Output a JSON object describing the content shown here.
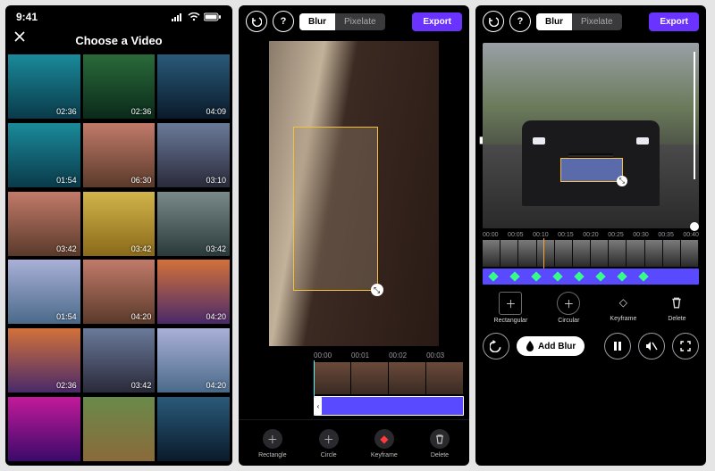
{
  "status": {
    "time": "9:41"
  },
  "gallery": {
    "title": "Choose a Video",
    "thumbs": [
      {
        "dur": "02:36",
        "cls": "ocean"
      },
      {
        "dur": "02:36",
        "cls": "forest"
      },
      {
        "dur": "04:09",
        "cls": "water"
      },
      {
        "dur": "01:54",
        "cls": "ocean"
      },
      {
        "dur": "06:30",
        "cls": "people"
      },
      {
        "dur": "03:10",
        "cls": "city"
      },
      {
        "dur": "03:42",
        "cls": "people"
      },
      {
        "dur": "03:42",
        "cls": "food"
      },
      {
        "dur": "03:42",
        "cls": "bridge"
      },
      {
        "dur": "01:54",
        "cls": "beach"
      },
      {
        "dur": "04:20",
        "cls": "people"
      },
      {
        "dur": "04:20",
        "cls": "sunset"
      },
      {
        "dur": "02:36",
        "cls": "sunset"
      },
      {
        "dur": "03:42",
        "cls": "city"
      },
      {
        "dur": "04:20",
        "cls": "beach"
      },
      {
        "dur": "",
        "cls": "abstract"
      },
      {
        "dur": "",
        "cls": "hill"
      },
      {
        "dur": "",
        "cls": "water"
      }
    ]
  },
  "editor": {
    "tabs": {
      "blur": "Blur",
      "pixelate": "Pixelate"
    },
    "export": "Export",
    "ticks2": [
      "00:00",
      "00:01",
      "00:02",
      "00:03"
    ],
    "tools": {
      "rectangle": "Rectangle",
      "circle": "Circle",
      "keyframe": "Keyframe",
      "delete": "Delete"
    }
  },
  "editor3": {
    "ticks": [
      "00:00",
      "00:05",
      "00:10",
      "00:15",
      "00:20",
      "00:25",
      "00:30",
      "00:35",
      "00:40"
    ],
    "tools": {
      "rectangular": "Rectangular",
      "circular": "Circular",
      "keyframe": "Keyframe",
      "delete": "Delete"
    },
    "add_blur": "Add Blur"
  }
}
